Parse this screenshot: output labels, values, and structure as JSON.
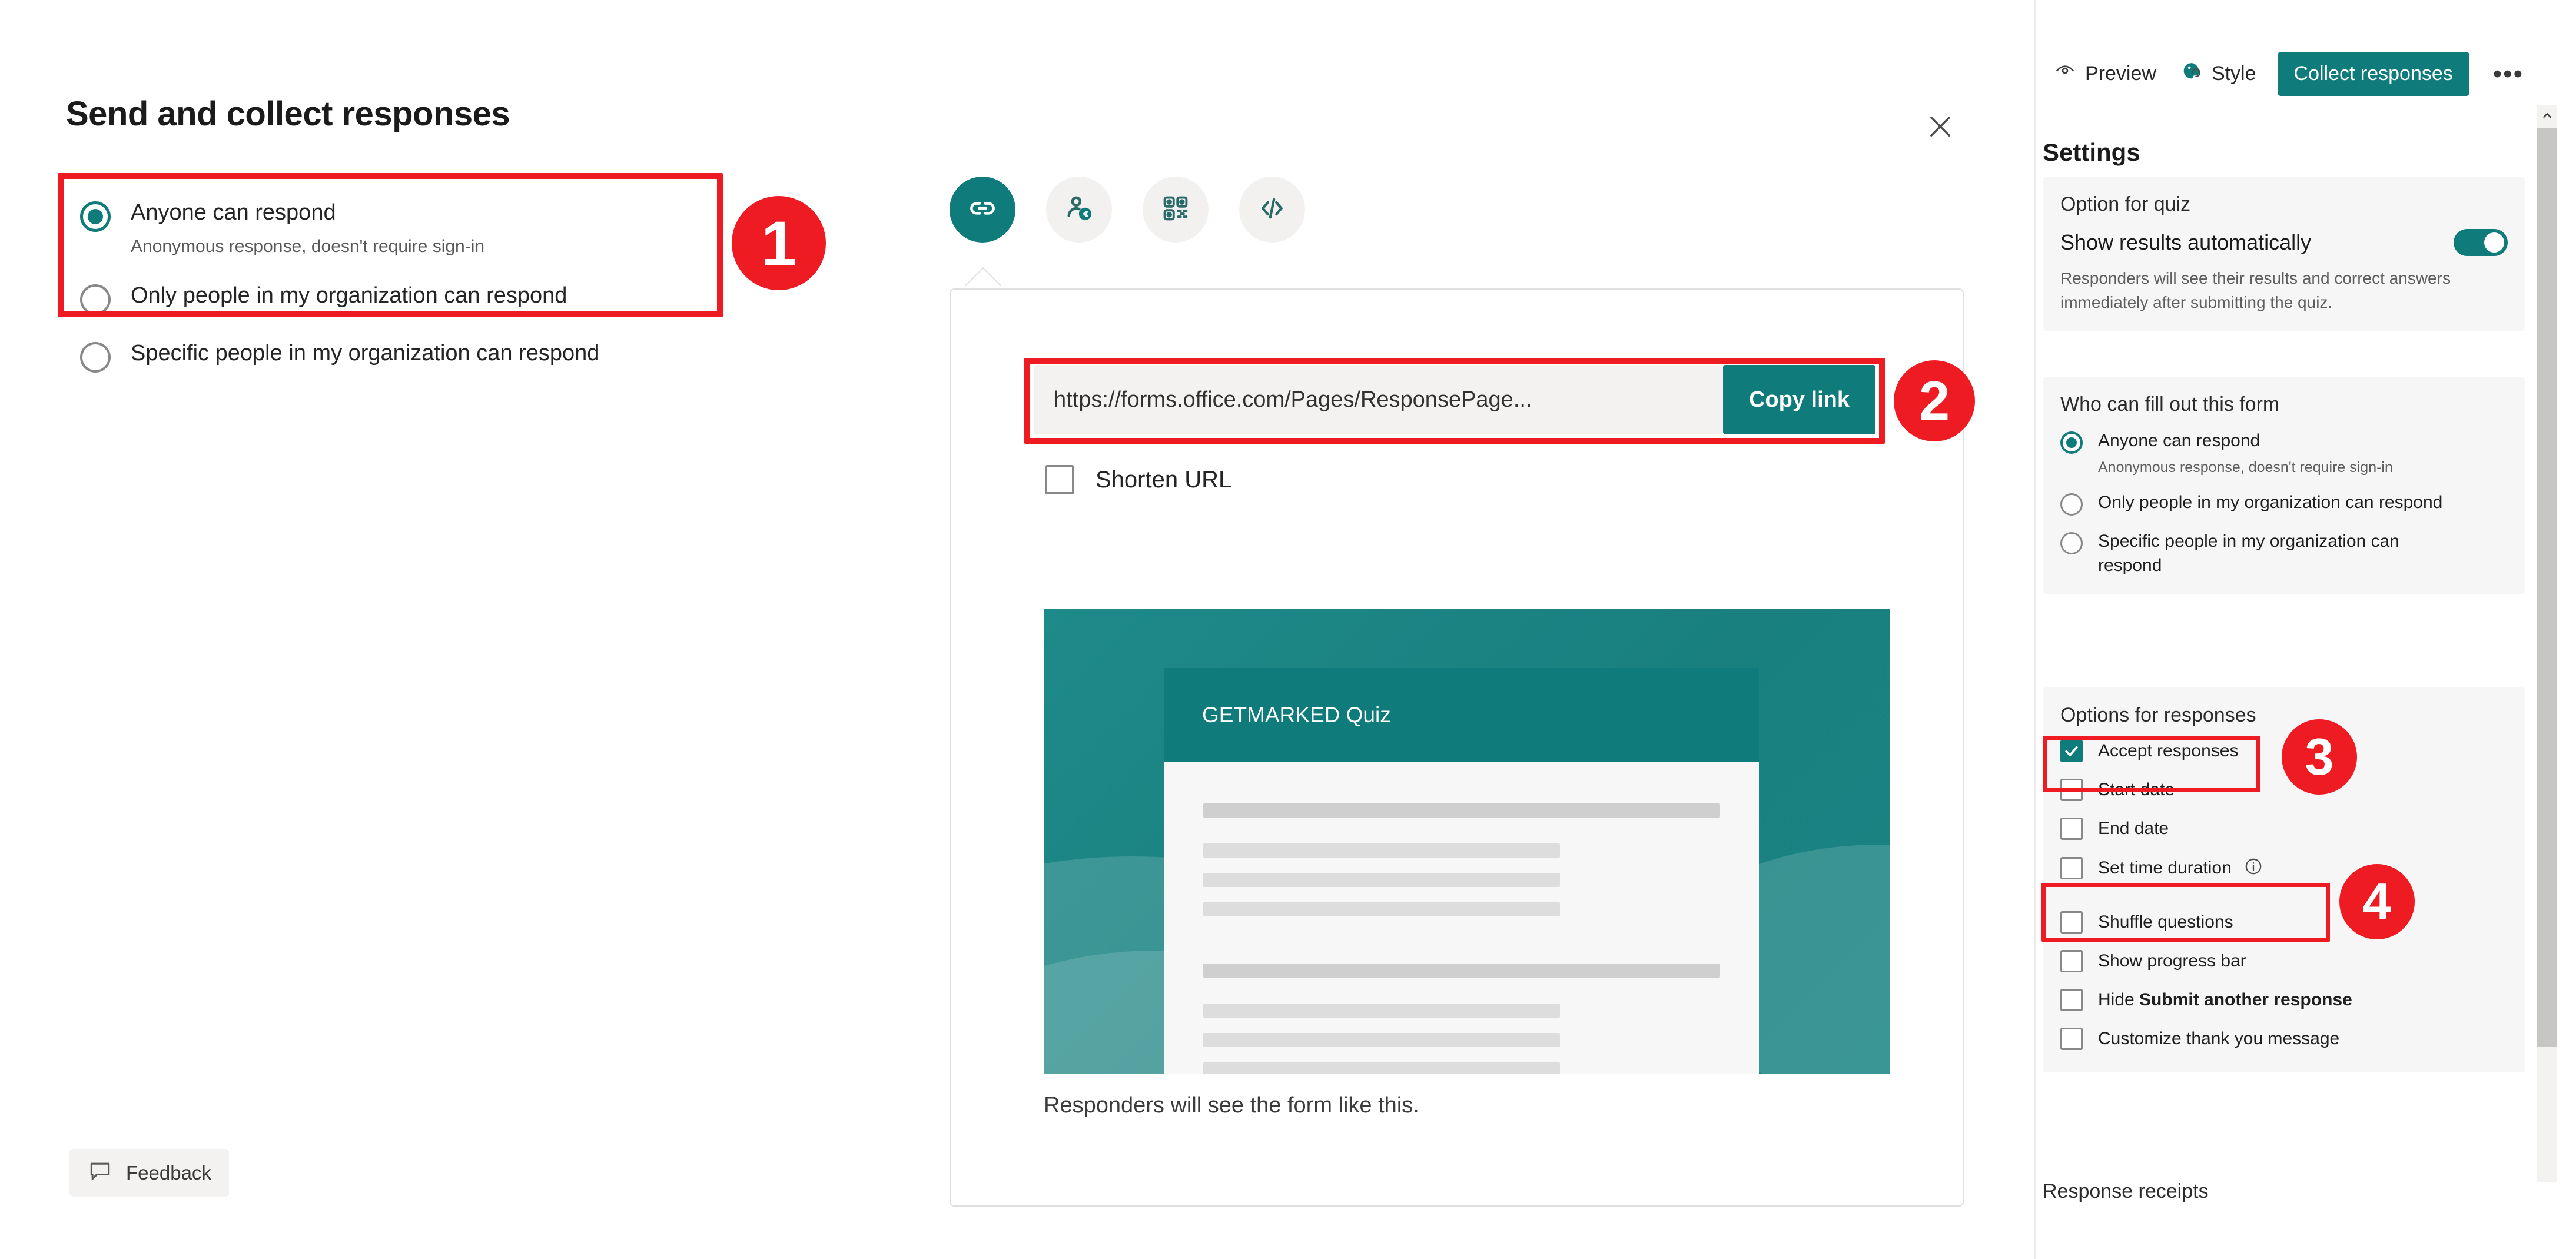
{
  "dialog": {
    "title": "Send and collect responses",
    "close_icon": "close-icon",
    "audience_options": [
      {
        "label": "Anyone can respond",
        "sub": "Anonymous response, doesn't require sign-in",
        "selected": true
      },
      {
        "label": "Only people in my organization can respond",
        "sub": "",
        "selected": false
      },
      {
        "label": "Specific people in my organization can respond",
        "sub": "",
        "selected": false
      }
    ],
    "feedback": {
      "label": "Feedback",
      "icon": "comment-icon"
    }
  },
  "share": {
    "tabs": [
      {
        "icon": "link-icon",
        "name": "link",
        "active": true
      },
      {
        "icon": "person-share-icon",
        "name": "invite-people",
        "active": false
      },
      {
        "icon": "qr-code-icon",
        "name": "qr-code",
        "active": false
      },
      {
        "icon": "embed-code-icon",
        "name": "embed",
        "active": false
      }
    ],
    "link_value": "https://forms.office.com/Pages/ResponsePage...",
    "copy_label": "Copy link",
    "shorten_label": "Shorten URL",
    "shorten_checked": false,
    "preview_title": "GETMARKED Quiz",
    "preview_caption": "Responders will see the form like this."
  },
  "toolbar": {
    "preview_label": "Preview",
    "preview_icon": "eye-icon",
    "style_label": "Style",
    "style_icon": "palette-icon",
    "collect_label": "Collect responses",
    "more_label": "•••"
  },
  "settings": {
    "title": "Settings",
    "quiz": {
      "group_title": "Option for quiz",
      "toggle_label": "Show results automatically",
      "toggle_on": true,
      "help": "Responders will see their results and correct answers immediately after submitting the quiz."
    },
    "who": {
      "group_title": "Who can fill out this form",
      "options": [
        {
          "label": "Anyone can respond",
          "sub": "Anonymous response, doesn't require sign-in",
          "selected": true
        },
        {
          "label": "Only people in my organization can respond",
          "sub": "",
          "selected": false
        },
        {
          "label": "Specific people in my organization can respond",
          "sub": "",
          "selected": false
        }
      ]
    },
    "responses": {
      "group_title": "Options for responses",
      "items": [
        {
          "label": "Accept responses",
          "checked": true,
          "info": false
        },
        {
          "label": "Start date",
          "checked": false,
          "info": false
        },
        {
          "label": "End date",
          "checked": false,
          "info": false
        },
        {
          "label": "Set time duration",
          "checked": false,
          "info": true
        },
        {
          "label": "Shuffle questions",
          "checked": false,
          "info": false
        },
        {
          "label": "Show progress bar",
          "checked": false,
          "info": false
        },
        {
          "label": "Hide Submit another response",
          "label_plain": "Hide ",
          "label_bold": "Submit another response",
          "checked": false,
          "info": false
        },
        {
          "label": "Customize thank you message",
          "checked": false,
          "info": false
        }
      ]
    },
    "receipts_title": "Response receipts"
  },
  "annotations": {
    "badges": [
      {
        "number": "1"
      },
      {
        "number": "2"
      },
      {
        "number": "3"
      },
      {
        "number": "4"
      }
    ],
    "color": "#ee1b22"
  }
}
